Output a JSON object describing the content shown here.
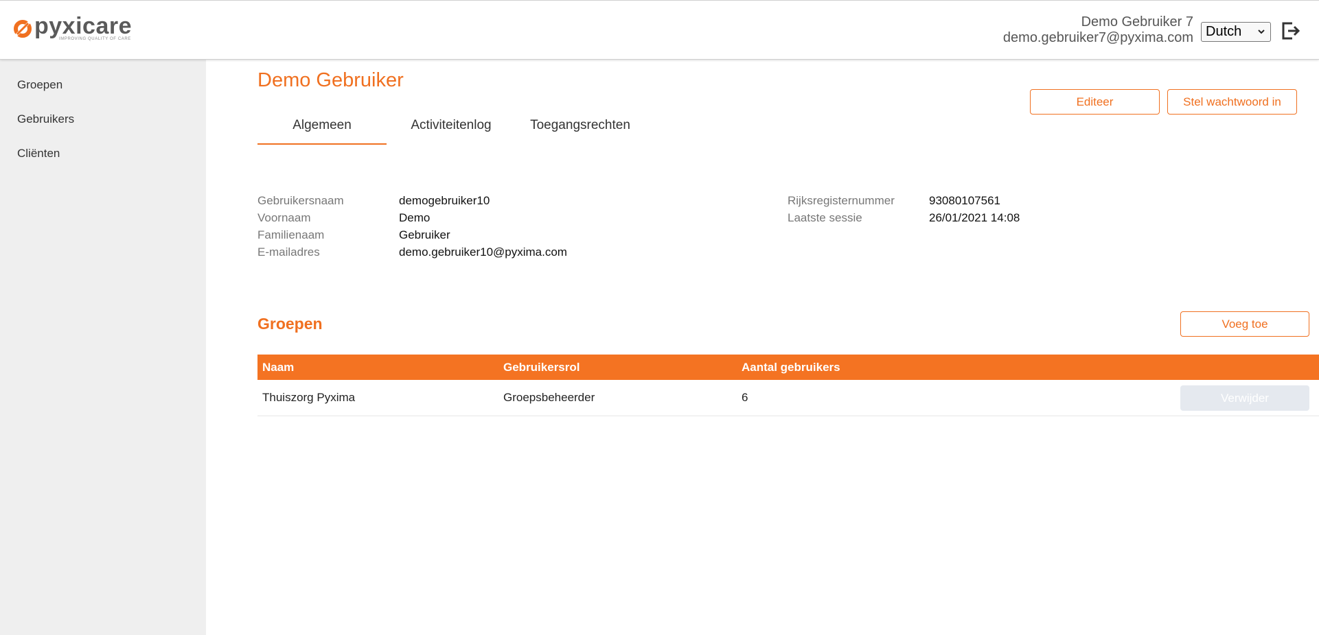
{
  "header": {
    "logo_name": "pyxicare",
    "logo_tagline": "IMPROVING QUALITY OF CARE",
    "user_name": "Demo Gebruiker 7",
    "user_email": "demo.gebruiker7@pyxima.com",
    "language": "Dutch",
    "logout_icon": "logout-icon"
  },
  "sidebar": {
    "items": [
      {
        "label": "Groepen"
      },
      {
        "label": "Gebruikers"
      },
      {
        "label": "Cliënten"
      }
    ]
  },
  "main": {
    "title": "Demo Gebruiker",
    "edit_label": "Editeer",
    "password_label": "Stel wachtwoord in",
    "tabs": [
      {
        "label": "Algemeen",
        "active": true
      },
      {
        "label": "Activiteitenlog",
        "active": false
      },
      {
        "label": "Toegangsrechten",
        "active": false
      }
    ],
    "info_left": [
      {
        "label": "Gebruikersnaam",
        "value": "demogebruiker10"
      },
      {
        "label": "Voornaam",
        "value": "Demo"
      },
      {
        "label": "Familienaam",
        "value": "Gebruiker"
      },
      {
        "label": "E-mailadres",
        "value": "demo.gebruiker10@pyxima.com"
      }
    ],
    "info_right": [
      {
        "label": "Rijksregisternummer",
        "value": "93080107561"
      },
      {
        "label": "Laatste sessie",
        "value": "26/01/2021 14:08"
      }
    ],
    "groups_title": "Groepen",
    "add_label": "Voeg toe",
    "table": {
      "headers": [
        "Naam",
        "Gebruikersrol",
        "Aantal gebruikers"
      ],
      "rows": [
        {
          "name": "Thuiszorg Pyxima",
          "role": "Groepsbeheerder",
          "count": "6",
          "delete_label": "Verwijder"
        }
      ]
    }
  },
  "colors": {
    "accent": "#f07020",
    "table_header": "#f47322",
    "sidebar_bg": "#efefef",
    "disabled_button": "#e5e9ef"
  }
}
